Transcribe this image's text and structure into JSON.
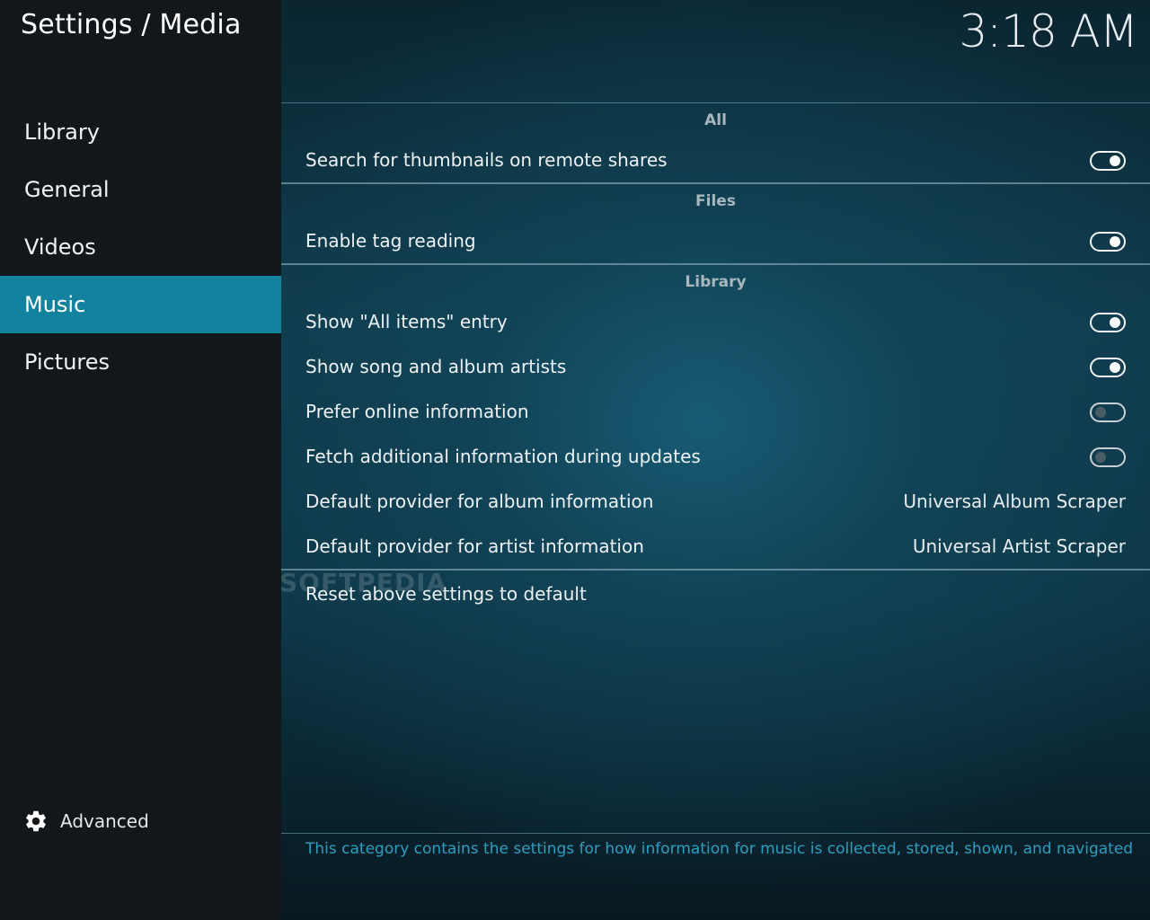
{
  "header": {
    "title": "Settings / Media",
    "clock": "3:18 AM"
  },
  "sidebar": {
    "items": [
      {
        "label": "Library",
        "active": false
      },
      {
        "label": "General",
        "active": false
      },
      {
        "label": "Videos",
        "active": false
      },
      {
        "label": "Music",
        "active": true
      },
      {
        "label": "Pictures",
        "active": false
      }
    ],
    "advanced_label": "Advanced",
    "advanced_icon": "gear-icon"
  },
  "settings": {
    "groups": [
      {
        "header": "All",
        "rows": [
          {
            "label": "Search for thumbnails on remote shares",
            "type": "toggle",
            "value": true
          }
        ]
      },
      {
        "header": "Files",
        "rows": [
          {
            "label": "Enable tag reading",
            "type": "toggle",
            "value": true
          }
        ]
      },
      {
        "header": "Library",
        "rows": [
          {
            "label": "Show \"All items\" entry",
            "type": "toggle",
            "value": true
          },
          {
            "label": "Show song and album artists",
            "type": "toggle",
            "value": true
          },
          {
            "label": "Prefer online information",
            "type": "toggle",
            "value": false
          },
          {
            "label": "Fetch additional information during updates",
            "type": "toggle",
            "value": false
          },
          {
            "label": "Default provider for album information",
            "type": "value",
            "value": "Universal Album Scraper"
          },
          {
            "label": "Default provider for artist information",
            "type": "value",
            "value": "Universal Artist Scraper"
          }
        ]
      }
    ],
    "reset_label": "Reset above settings to default"
  },
  "watermark": "SOFTPEDIA",
  "description": "This category contains the settings for how information for music is collected, stored, shown, and navigated",
  "colors": {
    "accent": "#12829f",
    "sidebar_bg": "#12171c",
    "description_text": "#2e9ec0"
  }
}
